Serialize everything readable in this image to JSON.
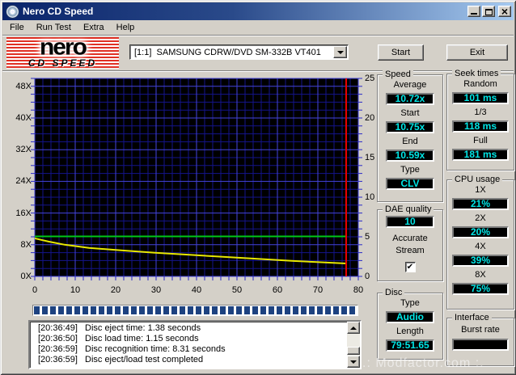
{
  "window": {
    "title": "Nero CD Speed"
  },
  "menu": {
    "items": [
      "File",
      "Run Test",
      "Extra",
      "Help"
    ]
  },
  "toolbar": {
    "logo_line1": "nero",
    "logo_line2": "CD SPEED",
    "drive": "[1:1]  SAMSUNG CDRW/DVD SM-332B VT401",
    "start": "Start",
    "exit": "Exit"
  },
  "chart_data": {
    "type": "line",
    "x_axis": {
      "min": 0,
      "max": 80,
      "unit": "min",
      "ticks": [
        0,
        10,
        20,
        30,
        40,
        50,
        60,
        70,
        80
      ],
      "minor_step": 2,
      "major_step": 10
    },
    "y_axis_left": {
      "min": 0,
      "max": 50,
      "unit": "x (CD speed)",
      "labels": [
        "0X",
        "8X",
        "16X",
        "24X",
        "32X",
        "40X",
        "48X"
      ],
      "label_step": 8
    },
    "y_axis_right": {
      "min": 0,
      "max": 25,
      "unit": "x1000 RPM",
      "labels": [
        0,
        5,
        10,
        15,
        20,
        25
      ],
      "label_step": 5,
      "minor_step": 1
    },
    "grid": true,
    "plot_bg": "#000000",
    "grid_minor": "#14148c",
    "grid_major": "#4444dc",
    "tick_color": "#2a2ac8",
    "series": [
      {
        "name": "read-speed",
        "color": "#00c818",
        "axis": "left",
        "points": [
          [
            0,
            10.1
          ],
          [
            77,
            10.1
          ]
        ]
      },
      {
        "name": "rotation-speed",
        "color": "#e8e800",
        "axis": "right",
        "points": [
          [
            0,
            4.8
          ],
          [
            3.4,
            4.4
          ],
          [
            7.4,
            4.0
          ],
          [
            13.4,
            3.6
          ],
          [
            21,
            3.3
          ],
          [
            29.4,
            3.0
          ],
          [
            37.4,
            2.75
          ],
          [
            50.8,
            2.35
          ],
          [
            64,
            1.95
          ],
          [
            77,
            1.63
          ]
        ]
      }
    ],
    "end_marker": {
      "x": 77,
      "color": "#e80000"
    }
  },
  "progress": {
    "percent": 100
  },
  "log": {
    "lines": [
      {
        "time": "[20:36:49]",
        "text": "Disc eject time: 1.38 seconds"
      },
      {
        "time": "[20:36:50]",
        "text": "Disc load time: 1.15 seconds"
      },
      {
        "time": "[20:36:59]",
        "text": "Disc recognition time: 8.31 seconds"
      },
      {
        "time": "[20:36:59]",
        "text": "Disc eject/load test completed"
      }
    ]
  },
  "panels": {
    "speed": {
      "title": "Speed",
      "items": [
        {
          "label": "Average",
          "value": "10.72x"
        },
        {
          "label": "Start",
          "value": "10.75x"
        },
        {
          "label": "End",
          "value": "10.59x"
        },
        {
          "label": "Type",
          "value": "CLV"
        }
      ]
    },
    "seek": {
      "title": "Seek times",
      "items": [
        {
          "label": "Random",
          "value": "101 ms"
        },
        {
          "label": "1/3",
          "value": "118 ms"
        },
        {
          "label": "Full",
          "value": "181 ms"
        }
      ]
    },
    "dae": {
      "title": "DAE quality",
      "value": "10",
      "accurate_label_1": "Accurate",
      "accurate_label_2": "Stream",
      "checked": true
    },
    "cpu": {
      "title": "CPU usage",
      "items": [
        {
          "label": "1X",
          "value": "21%"
        },
        {
          "label": "2X",
          "value": "20%"
        },
        {
          "label": "4X",
          "value": "39%"
        },
        {
          "label": "8X",
          "value": "75%"
        }
      ]
    },
    "disc": {
      "title": "Disc",
      "items": [
        {
          "label": "Type",
          "value": "Audio"
        },
        {
          "label": "Length",
          "value": "79:51.65"
        }
      ]
    },
    "interface": {
      "title": "Interface",
      "label": "Burst rate",
      "value": ""
    }
  },
  "icons": {
    "check": "✔"
  },
  "watermark": ".: Modfactor.com :.",
  "colors": {
    "titlebar_left": "#0a246a",
    "titlebar_right": "#a6caf0",
    "chrome": "#d4d0c8",
    "lcd_bg": "#000000",
    "lcd_fg": "#00e6e6",
    "progress_bar": "#1d4280"
  }
}
